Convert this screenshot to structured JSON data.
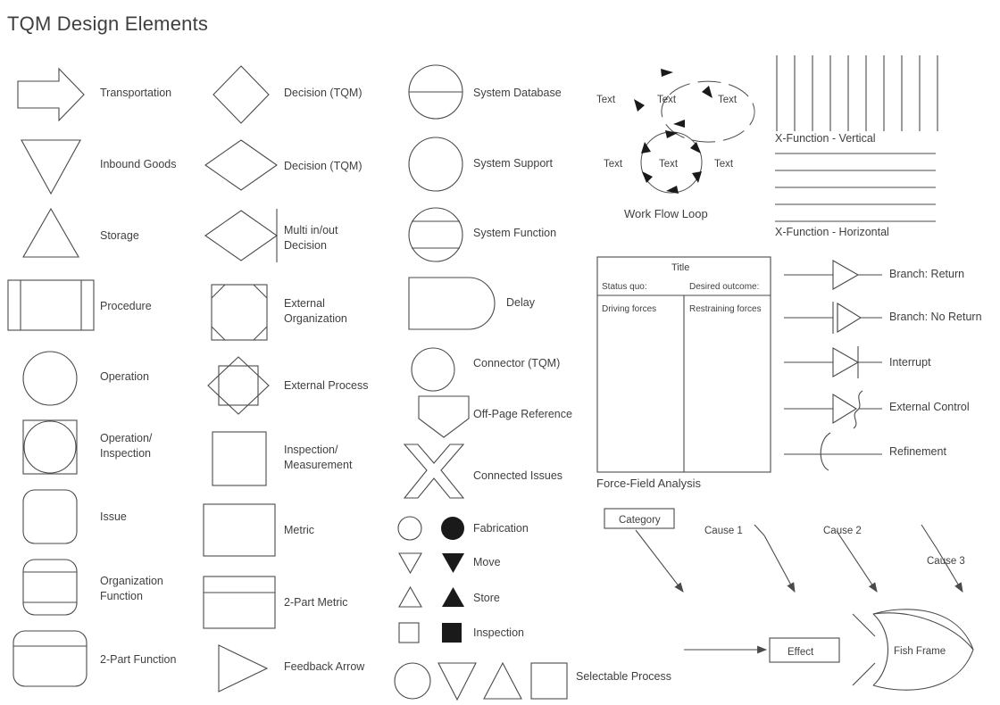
{
  "page": {
    "title": "TQM Design Elements",
    "stroke_color": "#4a4a4a",
    "text_color": "#3f3f3f",
    "fill_color": "#1a1a1a",
    "background": "#ffffff"
  },
  "columns": [
    {
      "name": "column-1",
      "items": [
        {
          "label": "Transportation",
          "icon": "arrow-right-block-shape"
        },
        {
          "label": "Inbound Goods",
          "icon": "triangle-down-shape"
        },
        {
          "label": "Storage",
          "icon": "triangle-up-shape"
        },
        {
          "label": "Procedure",
          "icon": "procedure-rectangle-shape"
        },
        {
          "label": "Operation",
          "icon": "circle-shape"
        },
        {
          "label": "Operation/\nInspection",
          "icon": "circle-in-square-shape"
        },
        {
          "label": "Issue",
          "icon": "rounded-square-shape"
        },
        {
          "label": "Organization\nFunction",
          "icon": "organization-function-shape"
        },
        {
          "label": "2-Part Function",
          "icon": "two-part-function-shape"
        }
      ]
    },
    {
      "name": "column-2",
      "items": [
        {
          "label": "Decision (TQM)",
          "icon": "diamond-tall-shape"
        },
        {
          "label": "Decision (TQM)",
          "icon": "diamond-wide-shape"
        },
        {
          "label": "Multi in/out\nDecision",
          "icon": "multi-in-out-decision-shape"
        },
        {
          "label": "External\nOrganization",
          "icon": "external-organization-shape"
        },
        {
          "label": "External Process",
          "icon": "external-process-shape"
        },
        {
          "label": "Inspection/\nMeasurement",
          "icon": "square-shape"
        },
        {
          "label": "Metric",
          "icon": "metric-rectangle-shape"
        },
        {
          "label": "2-Part Metric",
          "icon": "two-part-metric-shape"
        },
        {
          "label": "Feedback Arrow",
          "icon": "triangle-right-shape"
        }
      ]
    },
    {
      "name": "column-3",
      "items": [
        {
          "label": "System Database",
          "icon": "circle-with-midline-shape"
        },
        {
          "label": "System Support",
          "icon": "circle-shape"
        },
        {
          "label": "System Function",
          "icon": "circle-with-two-lines-shape"
        },
        {
          "label": "Delay",
          "icon": "delay-d-shape"
        },
        {
          "label": "Connector (TQM)",
          "icon": "small-circle-shape"
        },
        {
          "label": "Off-Page Reference",
          "icon": "off-page-reference-shape"
        },
        {
          "label": "Connected Issues",
          "icon": "x-cross-shape"
        },
        {
          "label": "Fabrication",
          "icon": "circle-pair-shape"
        },
        {
          "label": "Move",
          "icon": "triangle-down-pair-shape"
        },
        {
          "label": "Store",
          "icon": "triangle-up-pair-shape"
        },
        {
          "label": "Inspection",
          "icon": "square-pair-shape"
        },
        {
          "label": "Selectable Process",
          "icon": "selectable-process-shape"
        }
      ]
    }
  ],
  "work_flow_loop": {
    "caption": "Work Flow Loop",
    "ellipse_labels": {
      "left": "Text",
      "center": "Text",
      "right": "Text"
    },
    "circle_labels": {
      "left": "Text",
      "center": "Text",
      "right": "Text"
    }
  },
  "x_function": {
    "vertical_caption": "X-Function - Vertical",
    "vertical_line_count": 10,
    "horizontal_caption": "X-Function - Horizontal",
    "horizontal_line_count": 5
  },
  "force_field": {
    "caption": "Force-Field Analysis",
    "title": "Title",
    "status_quo": "Status quo:",
    "desired_outcome": "Desired outcome:",
    "driving_forces": "Driving forces",
    "restraining_forces": "Restraining forces"
  },
  "branch_symbols": [
    {
      "label": "Branch: Return",
      "icon": "branch-return-shape"
    },
    {
      "label": "Branch: No Return",
      "icon": "branch-no-return-shape"
    },
    {
      "label": "Interrupt",
      "icon": "interrupt-shape"
    },
    {
      "label": "External Control",
      "icon": "external-control-shape"
    },
    {
      "label": "Refinement",
      "icon": "refinement-shape"
    }
  ],
  "fishbone": {
    "category": "Category",
    "cause_1": "Cause 1",
    "cause_2": "Cause 2",
    "cause_3": "Cause 3",
    "effect": "Effect",
    "fish_frame": "Fish Frame"
  }
}
